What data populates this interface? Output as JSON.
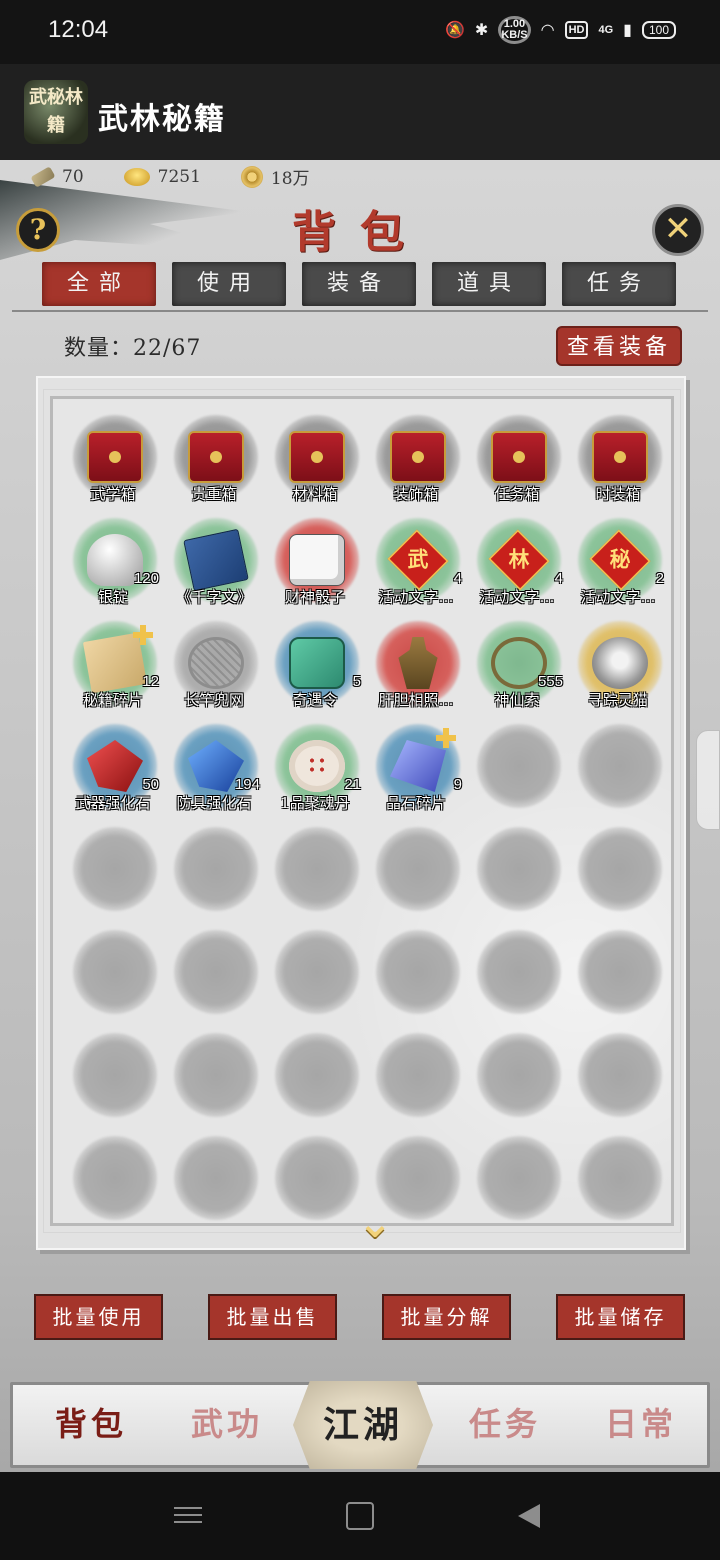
{
  "status_bar": {
    "time": "12:04",
    "net_speed_value": "1.00",
    "net_speed_unit": "KB/S",
    "hd": "HD",
    "signal": "4G",
    "battery": "100"
  },
  "app": {
    "icon_text": "武秘林籍",
    "title": "武林秘籍"
  },
  "currency": {
    "scroll_value": "70",
    "gold_value": "7251",
    "coin_value": "18万"
  },
  "header": {
    "help_icon": "?",
    "close_icon": "✕",
    "title": "背包"
  },
  "tabs": [
    {
      "label": "全部",
      "active": true
    },
    {
      "label": "使用",
      "active": false
    },
    {
      "label": "装备",
      "active": false
    },
    {
      "label": "道具",
      "active": false
    },
    {
      "label": "任务",
      "active": false
    }
  ],
  "inventory": {
    "count_label": "数量：22/67",
    "view_equipment_label": "查看装备",
    "items": [
      {
        "name": "武学箱",
        "qty": "",
        "icon": "chest-icon"
      },
      {
        "name": "贵重箱",
        "qty": "",
        "icon": "chest-icon"
      },
      {
        "name": "材料箱",
        "qty": "",
        "icon": "chest-icon"
      },
      {
        "name": "装饰箱",
        "qty": "",
        "icon": "chest-icon"
      },
      {
        "name": "任务箱",
        "qty": "",
        "icon": "chest-icon"
      },
      {
        "name": "时装箱",
        "qty": "",
        "icon": "chest-icon"
      },
      {
        "name": "银锭",
        "qty": "120",
        "icon": "silver-ingot-icon"
      },
      {
        "name": "《千字文》",
        "qty": "",
        "icon": "book-icon"
      },
      {
        "name": "财神骰子",
        "qty": "",
        "icon": "dice-icon"
      },
      {
        "name": "活动文字…",
        "qty": "4",
        "icon": "event-char-wu-icon",
        "glyph": "武"
      },
      {
        "name": "活动文字…",
        "qty": "4",
        "icon": "event-char-lin-icon",
        "glyph": "林"
      },
      {
        "name": "活动文字…",
        "qty": "2",
        "icon": "event-char-mi-icon",
        "glyph": "秘"
      },
      {
        "name": "秘籍碎片",
        "qty": "12",
        "icon": "scroll-fragment-icon"
      },
      {
        "name": "长竿兜网",
        "qty": "",
        "icon": "net-icon"
      },
      {
        "name": "奇遇令",
        "qty": "5",
        "icon": "jade-token-icon"
      },
      {
        "name": "肝胆相照…",
        "qty": "",
        "icon": "statue-icon"
      },
      {
        "name": "神仙索",
        "qty": "555",
        "icon": "rope-icon"
      },
      {
        "name": "寻踪灵猫",
        "qty": "",
        "icon": "cat-icon"
      },
      {
        "name": "武器强化石",
        "qty": "50",
        "icon": "red-crystal-icon"
      },
      {
        "name": "防具强化石",
        "qty": "194",
        "icon": "blue-crystal-icon"
      },
      {
        "name": "1品聚魂丹",
        "qty": "21",
        "icon": "pills-icon"
      },
      {
        "name": "晶石碎片",
        "qty": "9",
        "icon": "crystal-shard-icon"
      }
    ],
    "empty_slots": 26
  },
  "batch_actions": [
    {
      "label": "批量使用"
    },
    {
      "label": "批量出售"
    },
    {
      "label": "批量分解"
    },
    {
      "label": "批量储存"
    }
  ],
  "bottom_nav": {
    "items": [
      "背包",
      "武功",
      "任务",
      "日常"
    ],
    "center": "江湖"
  }
}
